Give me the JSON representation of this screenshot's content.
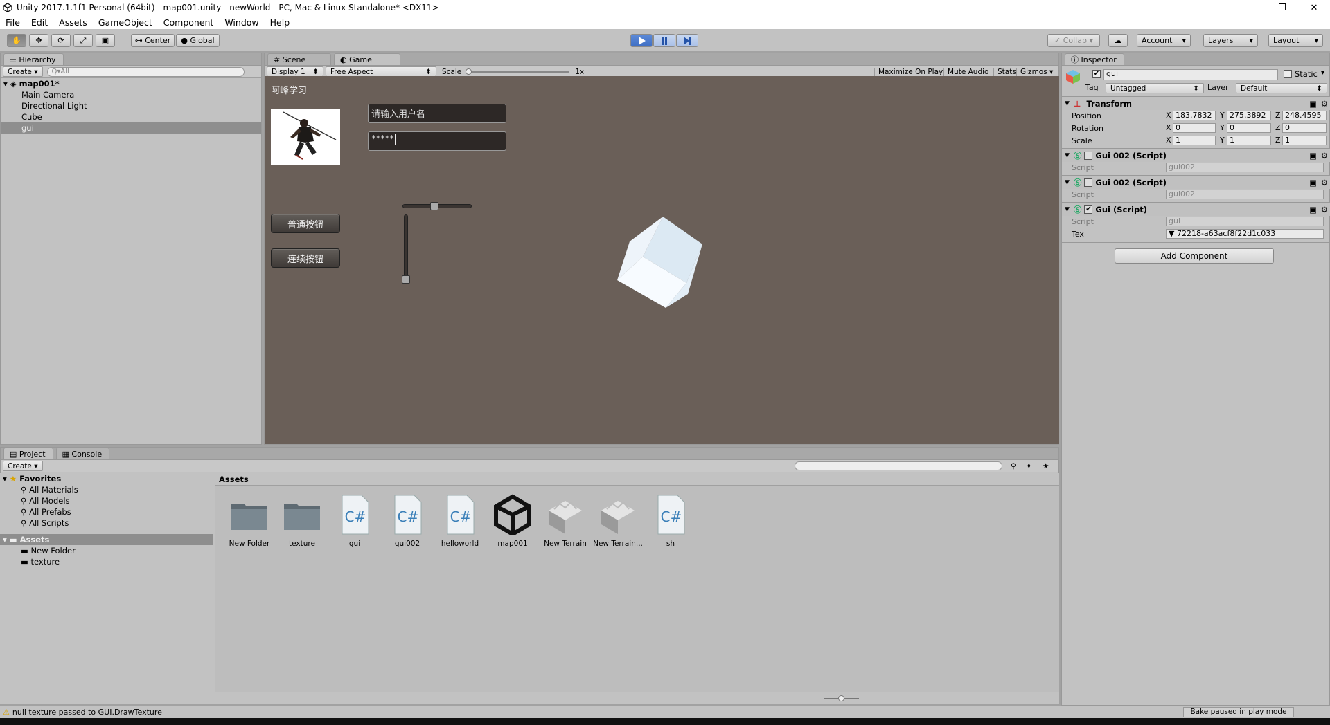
{
  "window": {
    "title": "Unity 2017.1.1f1 Personal (64bit) - map001.unity - newWorld - PC, Mac & Linux Standalone* <DX11>",
    "min": "—",
    "max": "❐",
    "close": "✕"
  },
  "menu": [
    "File",
    "Edit",
    "Assets",
    "GameObject",
    "Component",
    "Window",
    "Help"
  ],
  "toolbar": {
    "pivot": "Center",
    "space": "Global",
    "collab": "Collab",
    "account": "Account",
    "layers": "Layers",
    "layout": "Layout"
  },
  "hierarchy": {
    "tab": "Hierarchy",
    "create": "Create",
    "search_placeholder": "Q▾All",
    "scene": "map001*",
    "items": [
      "Main Camera",
      "Directional Light",
      "Cube",
      "gui"
    ],
    "selected": "gui"
  },
  "scene_tabs": {
    "scene": "Scene",
    "game": "Game"
  },
  "game_bar": {
    "display": "Display 1",
    "aspect": "Free Aspect",
    "scale_label": "Scale",
    "scale_value": "1x",
    "maximize": "Maximize On Play",
    "mute": "Mute Audio",
    "stats": "Stats",
    "gizmos": "Gizmos"
  },
  "game": {
    "label": "阿峰学习",
    "username_placeholder": "请输入用户名",
    "password_value": "*****",
    "btn_normal": "普通按钮",
    "btn_repeat": "连续按钮",
    "hslider_value": 0.45,
    "vslider_value": 1.0
  },
  "inspector": {
    "tab": "Inspector",
    "object_name": "gui",
    "static_label": "Static",
    "tag_label": "Tag",
    "tag_value": "Untagged",
    "layer_label": "Layer",
    "layer_value": "Default",
    "transform_title": "Transform",
    "position_label": "Position",
    "rotation_label": "Rotation",
    "scale_label": "Scale",
    "position": {
      "x": "183.7832",
      "y": "275.3892",
      "z": "248.4595"
    },
    "rotation": {
      "x": "0",
      "y": "0",
      "z": "0"
    },
    "scale": {
      "x": "1",
      "y": "1",
      "z": "1"
    },
    "components": [
      {
        "title": "Gui 002 (Script)",
        "script_label": "Script",
        "script": "gui002",
        "enabled": false
      },
      {
        "title": "Gui 002 (Script)",
        "script_label": "Script",
        "script": "gui002",
        "enabled": false
      },
      {
        "title": "Gui (Script)",
        "script_label": "Script",
        "script": "gui",
        "enabled": true
      }
    ],
    "tex_label": "Tex",
    "tex_value": "72218-a63acf8f22d1c033",
    "add_component": "Add Component"
  },
  "project": {
    "tab": "Project",
    "console_tab": "Console",
    "create": "Create",
    "favorites": "Favorites",
    "fav_items": [
      "All Materials",
      "All Models",
      "All Prefabs",
      "All Scripts"
    ],
    "assets_root": "Assets",
    "asset_folders": [
      "New Folder",
      "texture"
    ],
    "header": "Assets",
    "assets": [
      {
        "name": "New Folder",
        "kind": "folder"
      },
      {
        "name": "texture",
        "kind": "folder"
      },
      {
        "name": "gui",
        "kind": "script"
      },
      {
        "name": "gui002",
        "kind": "script"
      },
      {
        "name": "helloworld",
        "kind": "script"
      },
      {
        "name": "map001",
        "kind": "unity"
      },
      {
        "name": "New Terrain",
        "kind": "terrain"
      },
      {
        "name": "New Terrain...",
        "kind": "terrain"
      },
      {
        "name": "sh",
        "kind": "script"
      }
    ]
  },
  "status": {
    "message": "null texture passed to GUI.DrawTexture",
    "bake": "Bake paused in play mode"
  },
  "colors": {
    "game_bg": "#6a5f58",
    "play_active": "#4a7bd0",
    "panel": "#c2c2c2"
  }
}
